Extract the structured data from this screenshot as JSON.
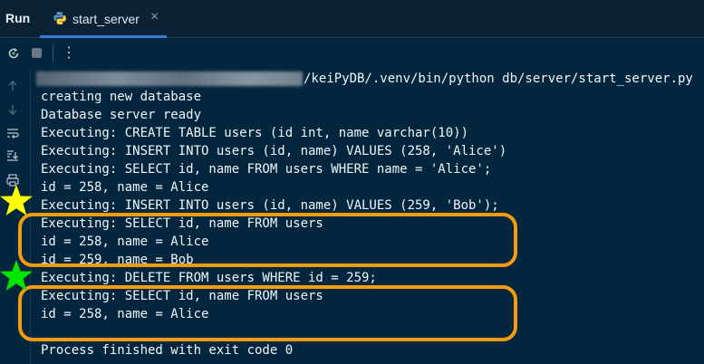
{
  "header": {
    "panel_title": "Run",
    "tab_title": "start_server",
    "tab_close": "×"
  },
  "toolbar": {
    "more_label": "⋮"
  },
  "console": {
    "command_visible": "/keiPyDB/.venv/bin/python db/server/start_server.py",
    "lines": [
      "creating new database",
      "Database server ready",
      "Executing: CREATE TABLE users (id int, name varchar(10))",
      "Executing: INSERT INTO users (id, name) VALUES (258, 'Alice')",
      "Executing: SELECT id, name FROM users WHERE name = 'Alice';",
      "id = 258, name = Alice",
      "Executing: INSERT INTO users (id, name) VALUES (259, 'Bob');",
      "Executing: SELECT id, name FROM users",
      "id = 258, name = Alice",
      "id = 259, name = Bob",
      "Executing: DELETE FROM users WHERE id = 259;",
      "Executing: SELECT id, name FROM users",
      "id = 258, name = Alice",
      "",
      "Process finished with exit code 0"
    ]
  },
  "annotations": {
    "highlight_color": "#f39c12",
    "star_colors": [
      "#ffff00",
      "#00e600"
    ]
  },
  "icons": [
    "python-file-icon",
    "rerun-icon",
    "stop-icon",
    "more-options-icon",
    "scroll-up-icon",
    "scroll-down-icon",
    "soft-wrap-icon",
    "scroll-to-end-icon",
    "print-icon"
  ]
}
